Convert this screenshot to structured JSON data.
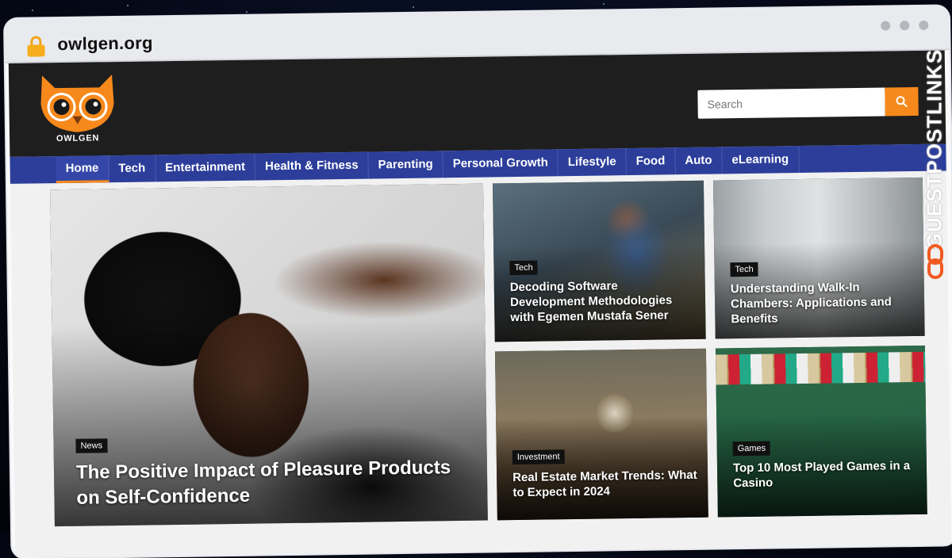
{
  "browser": {
    "url": "owlgen.org"
  },
  "site": {
    "logo_text": "OWLGEN",
    "search": {
      "placeholder": "Search"
    },
    "nav": [
      {
        "label": "Home"
      },
      {
        "label": "Tech"
      },
      {
        "label": "Entertainment"
      },
      {
        "label": "Health & Fitness"
      },
      {
        "label": "Parenting"
      },
      {
        "label": "Personal Growth"
      },
      {
        "label": "Lifestyle"
      },
      {
        "label": "Food"
      },
      {
        "label": "Auto"
      },
      {
        "label": "eLearning"
      }
    ],
    "featured": [
      {
        "category": "News",
        "title": "The Positive Impact of Pleasure Products on Self-Confidence"
      },
      {
        "category": "Tech",
        "title": "Decoding Software Development Methodologies with Egemen Mustafa Sener"
      },
      {
        "category": "Tech",
        "title": "Understanding Walk-In Chambers: Applications and Benefits"
      },
      {
        "category": "Investment",
        "title": "Real Estate Market Trends: What to Expect in 2024"
      },
      {
        "category": "Games",
        "title": "Top 10 Most Played Games in a Casino"
      }
    ]
  },
  "watermark": {
    "text": "GUESTPOSTLINKS"
  },
  "colors": {
    "accent": "#f7891c",
    "nav_bg": "#2c3e9a",
    "header_bg": "#1e1e1e"
  }
}
